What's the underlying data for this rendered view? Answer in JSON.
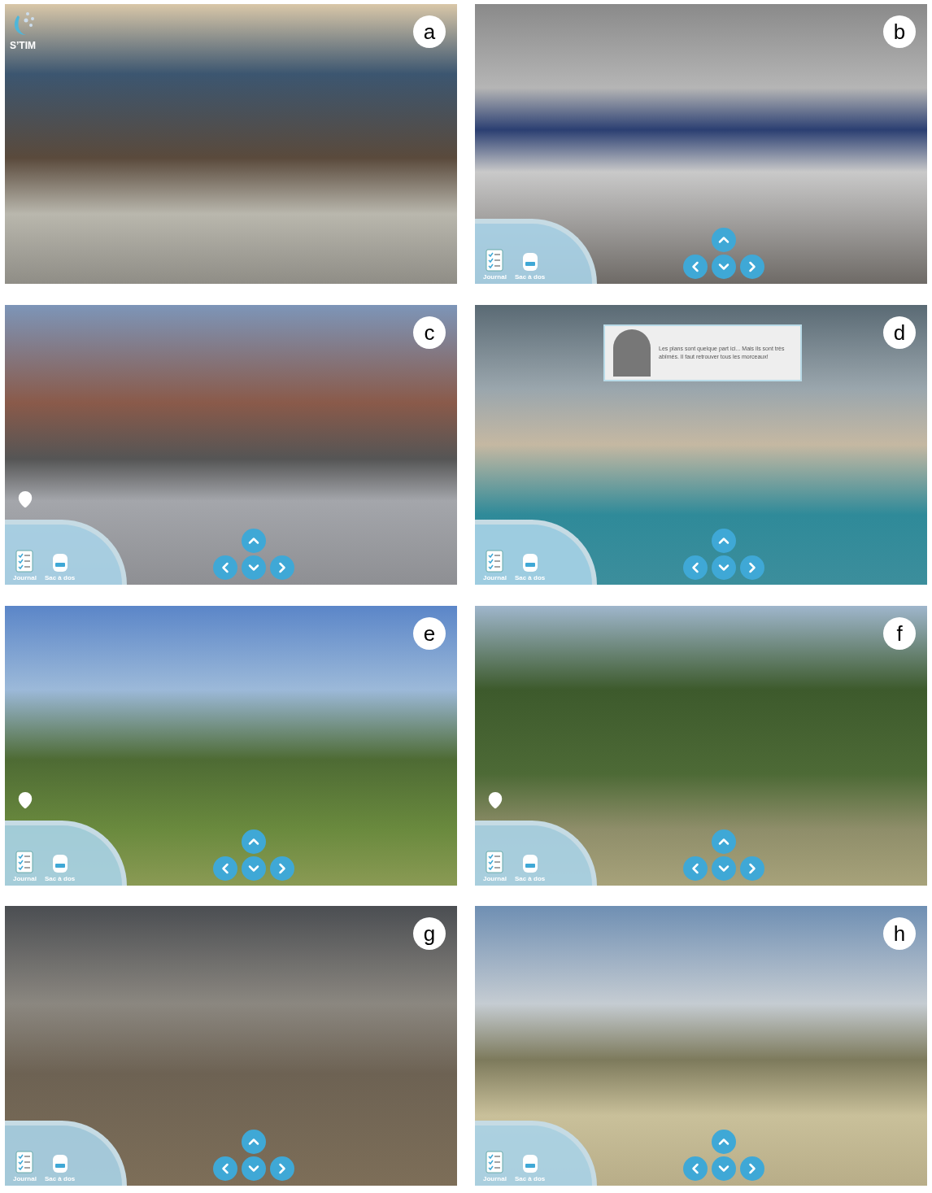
{
  "panels": [
    {
      "label": "a",
      "logo": "S’TIM",
      "map_pin": false
    },
    {
      "label": "b",
      "map_pin": false,
      "hud": {
        "journal": "Journal",
        "backpack": "Sac à dos"
      }
    },
    {
      "label": "c",
      "map_pin": true,
      "hud": {
        "journal": "Journal",
        "backpack": "Sac à dos"
      }
    },
    {
      "label": "d",
      "map_pin": false,
      "dialog": "Les plans sont quelque part ici... Mais ils sont très abîmés. Il faut retrouver tous les morceaux!",
      "hud": {
        "journal": "Journal",
        "backpack": "Sac à dos"
      }
    },
    {
      "label": "e",
      "map_pin": true,
      "hud": {
        "journal": "Journal",
        "backpack": "Sac à dos"
      }
    },
    {
      "label": "f",
      "map_pin": true,
      "hud": {
        "journal": "Journal",
        "backpack": "Sac à dos"
      }
    },
    {
      "label": "g",
      "map_pin": false,
      "hud": {
        "journal": "Journal",
        "backpack": "Sac à dos"
      }
    },
    {
      "label": "h",
      "map_pin": false,
      "hud": {
        "journal": "Journal",
        "backpack": "Sac à dos"
      }
    }
  ]
}
